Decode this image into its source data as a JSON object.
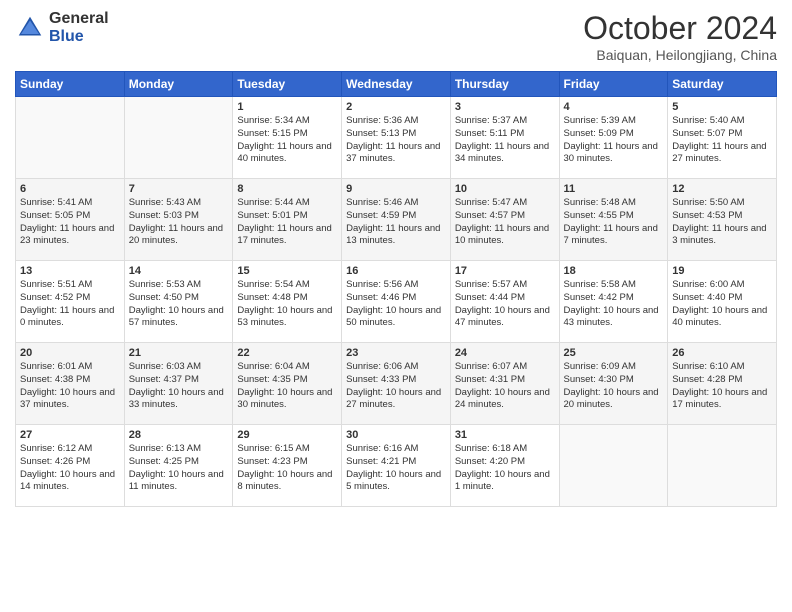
{
  "logo": {
    "general": "General",
    "blue": "Blue"
  },
  "title": "October 2024",
  "location": "Baiquan, Heilongjiang, China",
  "days_of_week": [
    "Sunday",
    "Monday",
    "Tuesday",
    "Wednesday",
    "Thursday",
    "Friday",
    "Saturday"
  ],
  "weeks": [
    [
      {
        "day": "",
        "info": ""
      },
      {
        "day": "",
        "info": ""
      },
      {
        "day": "1",
        "info": "Sunrise: 5:34 AM\nSunset: 5:15 PM\nDaylight: 11 hours and 40 minutes."
      },
      {
        "day": "2",
        "info": "Sunrise: 5:36 AM\nSunset: 5:13 PM\nDaylight: 11 hours and 37 minutes."
      },
      {
        "day": "3",
        "info": "Sunrise: 5:37 AM\nSunset: 5:11 PM\nDaylight: 11 hours and 34 minutes."
      },
      {
        "day": "4",
        "info": "Sunrise: 5:39 AM\nSunset: 5:09 PM\nDaylight: 11 hours and 30 minutes."
      },
      {
        "day": "5",
        "info": "Sunrise: 5:40 AM\nSunset: 5:07 PM\nDaylight: 11 hours and 27 minutes."
      }
    ],
    [
      {
        "day": "6",
        "info": "Sunrise: 5:41 AM\nSunset: 5:05 PM\nDaylight: 11 hours and 23 minutes."
      },
      {
        "day": "7",
        "info": "Sunrise: 5:43 AM\nSunset: 5:03 PM\nDaylight: 11 hours and 20 minutes."
      },
      {
        "day": "8",
        "info": "Sunrise: 5:44 AM\nSunset: 5:01 PM\nDaylight: 11 hours and 17 minutes."
      },
      {
        "day": "9",
        "info": "Sunrise: 5:46 AM\nSunset: 4:59 PM\nDaylight: 11 hours and 13 minutes."
      },
      {
        "day": "10",
        "info": "Sunrise: 5:47 AM\nSunset: 4:57 PM\nDaylight: 11 hours and 10 minutes."
      },
      {
        "day": "11",
        "info": "Sunrise: 5:48 AM\nSunset: 4:55 PM\nDaylight: 11 hours and 7 minutes."
      },
      {
        "day": "12",
        "info": "Sunrise: 5:50 AM\nSunset: 4:53 PM\nDaylight: 11 hours and 3 minutes."
      }
    ],
    [
      {
        "day": "13",
        "info": "Sunrise: 5:51 AM\nSunset: 4:52 PM\nDaylight: 11 hours and 0 minutes."
      },
      {
        "day": "14",
        "info": "Sunrise: 5:53 AM\nSunset: 4:50 PM\nDaylight: 10 hours and 57 minutes."
      },
      {
        "day": "15",
        "info": "Sunrise: 5:54 AM\nSunset: 4:48 PM\nDaylight: 10 hours and 53 minutes."
      },
      {
        "day": "16",
        "info": "Sunrise: 5:56 AM\nSunset: 4:46 PM\nDaylight: 10 hours and 50 minutes."
      },
      {
        "day": "17",
        "info": "Sunrise: 5:57 AM\nSunset: 4:44 PM\nDaylight: 10 hours and 47 minutes."
      },
      {
        "day": "18",
        "info": "Sunrise: 5:58 AM\nSunset: 4:42 PM\nDaylight: 10 hours and 43 minutes."
      },
      {
        "day": "19",
        "info": "Sunrise: 6:00 AM\nSunset: 4:40 PM\nDaylight: 10 hours and 40 minutes."
      }
    ],
    [
      {
        "day": "20",
        "info": "Sunrise: 6:01 AM\nSunset: 4:38 PM\nDaylight: 10 hours and 37 minutes."
      },
      {
        "day": "21",
        "info": "Sunrise: 6:03 AM\nSunset: 4:37 PM\nDaylight: 10 hours and 33 minutes."
      },
      {
        "day": "22",
        "info": "Sunrise: 6:04 AM\nSunset: 4:35 PM\nDaylight: 10 hours and 30 minutes."
      },
      {
        "day": "23",
        "info": "Sunrise: 6:06 AM\nSunset: 4:33 PM\nDaylight: 10 hours and 27 minutes."
      },
      {
        "day": "24",
        "info": "Sunrise: 6:07 AM\nSunset: 4:31 PM\nDaylight: 10 hours and 24 minutes."
      },
      {
        "day": "25",
        "info": "Sunrise: 6:09 AM\nSunset: 4:30 PM\nDaylight: 10 hours and 20 minutes."
      },
      {
        "day": "26",
        "info": "Sunrise: 6:10 AM\nSunset: 4:28 PM\nDaylight: 10 hours and 17 minutes."
      }
    ],
    [
      {
        "day": "27",
        "info": "Sunrise: 6:12 AM\nSunset: 4:26 PM\nDaylight: 10 hours and 14 minutes."
      },
      {
        "day": "28",
        "info": "Sunrise: 6:13 AM\nSunset: 4:25 PM\nDaylight: 10 hours and 11 minutes."
      },
      {
        "day": "29",
        "info": "Sunrise: 6:15 AM\nSunset: 4:23 PM\nDaylight: 10 hours and 8 minutes."
      },
      {
        "day": "30",
        "info": "Sunrise: 6:16 AM\nSunset: 4:21 PM\nDaylight: 10 hours and 5 minutes."
      },
      {
        "day": "31",
        "info": "Sunrise: 6:18 AM\nSunset: 4:20 PM\nDaylight: 10 hours and 1 minute."
      },
      {
        "day": "",
        "info": ""
      },
      {
        "day": "",
        "info": ""
      }
    ]
  ]
}
